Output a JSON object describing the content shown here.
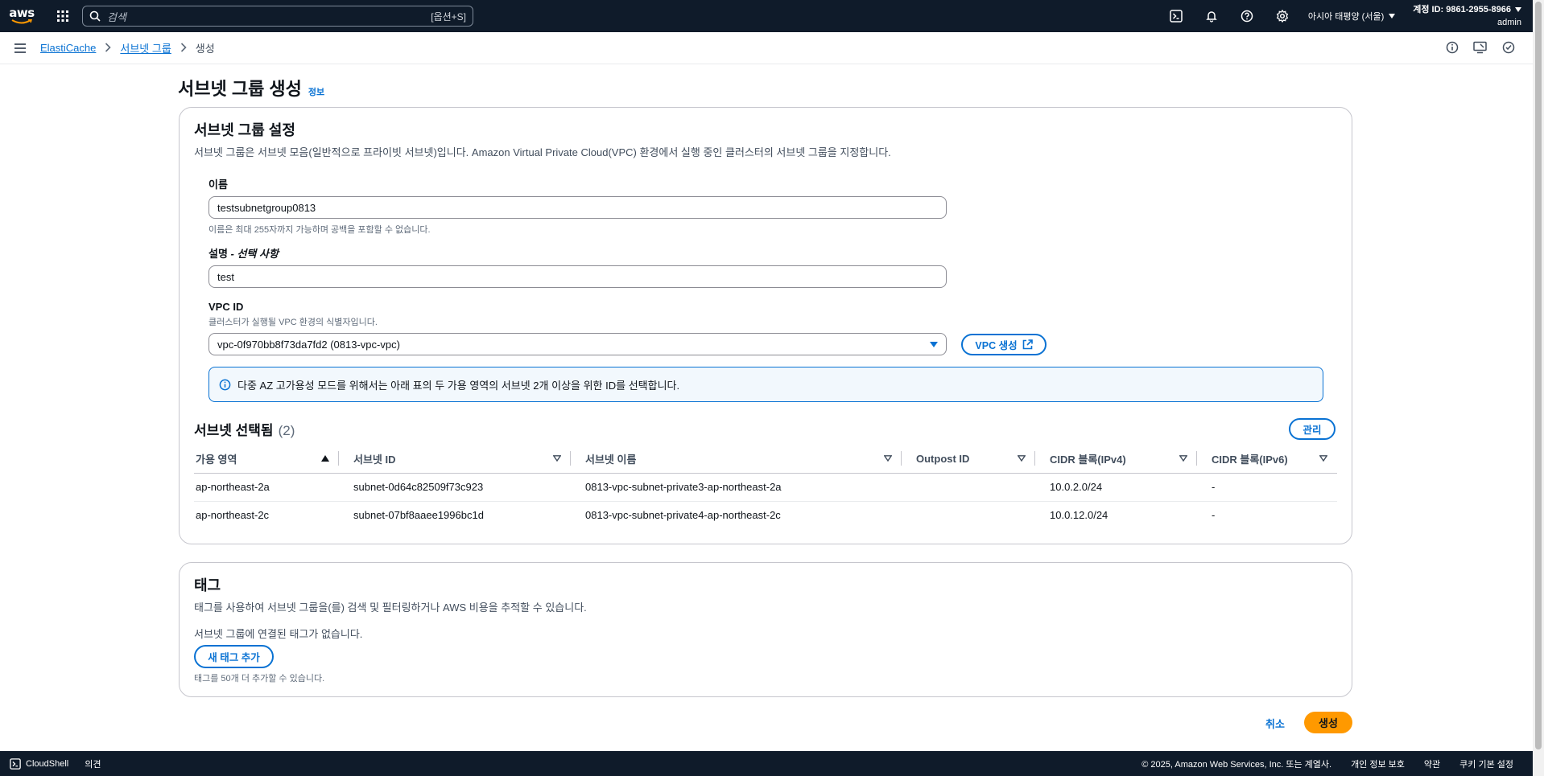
{
  "topnav": {
    "logo": "aws",
    "search_placeholder": "검색",
    "search_shortcut": "[옵션+S]",
    "region": "아시아 태평양 (서울)",
    "account_id": "계정 ID: 9861-2955-8966",
    "user": "admin"
  },
  "breadcrumb": {
    "items": [
      "ElastiCache",
      "서브넷 그룹"
    ],
    "current": "생성"
  },
  "page": {
    "title": "서브넷 그룹 생성",
    "info": "정보"
  },
  "settings": {
    "title": "서브넷 그룹 설정",
    "description": "서브넷 그룹은 서브넷 모음(일반적으로 프라이빗 서브넷)입니다. Amazon Virtual Private Cloud(VPC) 환경에서 실행 중인 클러스터의 서브넷 그룹을 지정합니다.",
    "name_label": "이름",
    "name_value": "testsubnetgroup0813",
    "name_hint": "이름은 최대 255자까지 가능하며 공백을 포함할 수 없습니다.",
    "desc_label": "설명",
    "desc_optional": " - 선택 사항",
    "desc_value": "test",
    "vpc_label": "VPC ID",
    "vpc_hint": "클러스터가 실행될 VPC 환경의 식별자입니다.",
    "vpc_value": "vpc-0f970bb8f73da7fd2 (0813-vpc-vpc)",
    "vpc_create": "VPC 생성",
    "alert": "다중 AZ 고가용성 모드를 위해서는 아래 표의 두 가용 영역의 서브넷 2개 이상을 위한 ID를 선택합니다."
  },
  "subnets": {
    "title": "서브넷 선택됨",
    "count": "(2)",
    "manage": "관리",
    "columns": [
      "가용 영역",
      "서브넷 ID",
      "서브넷 이름",
      "Outpost ID",
      "CIDR 블록(IPv4)",
      "CIDR 블록(IPv6)"
    ],
    "rows": [
      [
        "ap-northeast-2a",
        "subnet-0d64c82509f73c923",
        "0813-vpc-subnet-private3-ap-northeast-2a",
        "",
        "10.0.2.0/24",
        "-"
      ],
      [
        "ap-northeast-2c",
        "subnet-07bf8aaee1996bc1d",
        "0813-vpc-subnet-private4-ap-northeast-2c",
        "",
        "10.0.12.0/24",
        "-"
      ]
    ]
  },
  "tags": {
    "title": "태그",
    "description": "태그를 사용하여 서브넷 그룹을(를) 검색 및 필터링하거나 AWS 비용을 추적할 수 있습니다.",
    "empty": "서브넷 그룹에 연결된 태그가 없습니다.",
    "add": "새 태그 추가",
    "hint": "태그를 50개 더 추가할 수 있습니다."
  },
  "actions": {
    "cancel": "취소",
    "create": "생성"
  },
  "footer": {
    "cloudshell": "CloudShell",
    "feedback": "의견",
    "copyright": "© 2025, Amazon Web Services, Inc. 또는 계열사.",
    "privacy": "개인 정보 보호",
    "terms": "약관",
    "cookies": "쿠키 기본 설정"
  },
  "colors": {
    "nav_bg": "#0f1b2a",
    "link": "#0972d3",
    "primary": "#ff9900"
  }
}
